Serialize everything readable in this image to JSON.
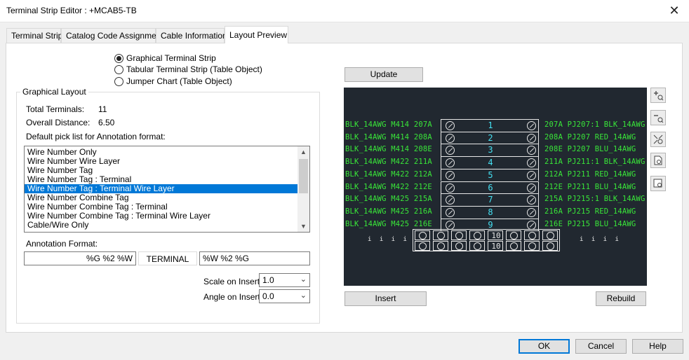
{
  "window": {
    "title": "Terminal Strip Editor : +MCAB5-TB",
    "close_glyph": "✕"
  },
  "tabs": [
    "Terminal Strip",
    "Catalog Code Assignment",
    "Cable Information",
    "Layout Preview"
  ],
  "layout_options": [
    {
      "label": "Graphical Terminal Strip",
      "selected": true
    },
    {
      "label": "Tabular Terminal Strip (Table Object)",
      "selected": false
    },
    {
      "label": "Jumper Chart (Table Object)",
      "selected": false
    }
  ],
  "graphical_layout": {
    "legend": "Graphical Layout",
    "total_terminals_label": "Total Terminals:",
    "total_terminals": "11",
    "overall_distance_label": "Overall Distance:",
    "overall_distance": "6.50",
    "pick_list_label": "Default pick list for Annotation format:",
    "pick_list": [
      "Wire Number Only",
      "Wire Number Wire Layer",
      "Wire Number Tag",
      "Wire Number Tag : Terminal",
      "Wire Number Tag : Terminal Wire Layer",
      "Wire Number Combine Tag",
      "Wire Number Combine Tag : Terminal",
      "Wire Number Combine Tag : Terminal Wire Layer",
      "Cable/Wire Only"
    ],
    "pick_list_selected_index": 4,
    "annotation_format_label": "Annotation Format:",
    "annotation_left": "%G %2 %W",
    "annotation_middle": "TERMINAL",
    "annotation_right": "%W %2 %G",
    "scale_label": "Scale on Insert:",
    "scale_value": "1.0",
    "angle_label": "Angle on Insert:",
    "angle_value": "0.0"
  },
  "preview": {
    "update_label": "Update",
    "insert_label": "Insert",
    "rebuild_label": "Rebuild",
    "rows": [
      {
        "left": "BLK_14AWG M414 207A",
        "num": "1",
        "right": "207A PJ207:1 BLK_14AWG"
      },
      {
        "left": "BLK_14AWG M414 208A",
        "num": "2",
        "right": "208A PJ207 RED_14AWG"
      },
      {
        "left": "BLK_14AWG M414 208E",
        "num": "3",
        "right": "208E PJ207 BLU_14AWG"
      },
      {
        "left": "BLK_14AWG M422 211A",
        "num": "4",
        "right": "211A PJ211:1 BLK_14AWG"
      },
      {
        "left": "BLK_14AWG M422 212A",
        "num": "5",
        "right": "212A PJ211 RED_14AWG"
      },
      {
        "left": "BLK_14AWG M422 212E",
        "num": "6",
        "right": "212E PJ211 BLU_14AWG"
      },
      {
        "left": "BLK_14AWG M425 215A",
        "num": "7",
        "right": "215A PJ215:1 BLK_14AWG"
      },
      {
        "left": "BLK_14AWG M425 216A",
        "num": "8",
        "right": "216A PJ215 RED_14AWG"
      },
      {
        "left": "BLK_14AWG M425 216E",
        "num": "9",
        "right": "216E PJ215 BLU_14AWG"
      }
    ],
    "bottom_num": "10",
    "bottom_marks": "i i i i",
    "bottom_marks_right": "i i i i",
    "colors": {
      "background": "#212830",
      "wire_text": "#39e639",
      "terminal_num": "#44e0f2"
    }
  },
  "zoom_tools": [
    "zoom-in-icon",
    "zoom-out-icon",
    "zoom-extents-icon",
    "zoom-window-icon",
    "zoom-previous-icon"
  ],
  "buttons": {
    "ok": "OK",
    "cancel": "Cancel",
    "help": "Help"
  }
}
